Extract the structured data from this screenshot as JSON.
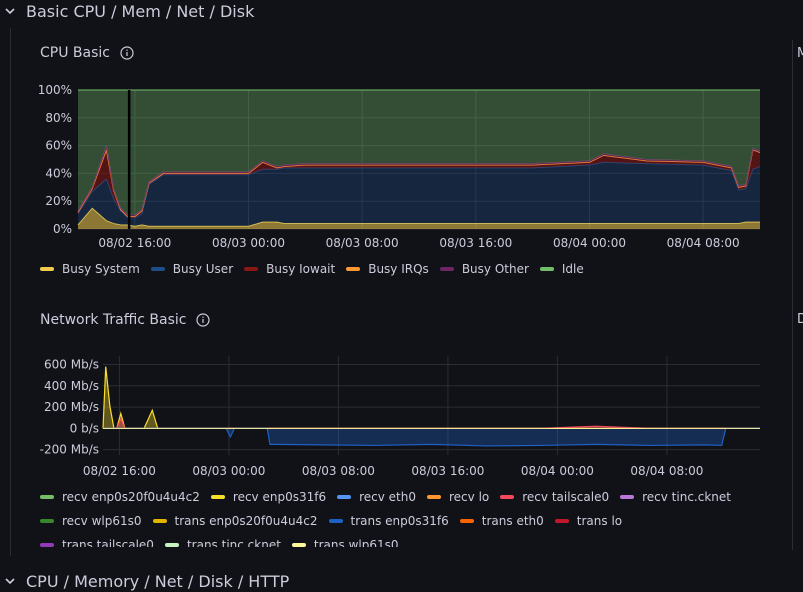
{
  "rows": [
    {
      "title": "Basic CPU / Mem / Net / Disk"
    },
    {
      "title": "CPU / Memory / Net / Disk / HTTP"
    }
  ],
  "cpu_panel": {
    "title": "CPU Basic",
    "legend": [
      {
        "label": "Busy System",
        "color": "#F2CC4C"
      },
      {
        "label": "Busy User",
        "color": "#1F4E87"
      },
      {
        "label": "Busy Iowait",
        "color": "#8A1616"
      },
      {
        "label": "Busy IRQs",
        "color": "#FF9830"
      },
      {
        "label": "Busy Other",
        "color": "#6E2564"
      },
      {
        "label": "Idle",
        "color": "#73BF69"
      }
    ]
  },
  "net_panel": {
    "title": "Network Traffic Basic",
    "legend": [
      {
        "label": "recv enp0s20f0u4u4c2",
        "color": "#73BF69"
      },
      {
        "label": "recv enp0s31f6",
        "color": "#FADE2A"
      },
      {
        "label": "recv eth0",
        "color": "#5794F2"
      },
      {
        "label": "recv lo",
        "color": "#FF9830"
      },
      {
        "label": "recv tailscale0",
        "color": "#F2495C"
      },
      {
        "label": "recv tinc.cknet",
        "color": "#B877D9"
      },
      {
        "label": "recv wlp61s0",
        "color": "#37872D"
      },
      {
        "label": "trans enp0s20f0u4u4c2",
        "color": "#E0B400"
      },
      {
        "label": "trans enp0s31f6",
        "color": "#1F60C4"
      },
      {
        "label": "trans eth0",
        "color": "#FA6400"
      },
      {
        "label": "trans lo",
        "color": "#C4162A"
      },
      {
        "label": "trans tailscale0",
        "color": "#8F3BB8"
      },
      {
        "label": "trans tinc.cknet",
        "color": "#C8F2C2"
      },
      {
        "label": "trans wlp61s0",
        "color": "#FFF899"
      }
    ]
  },
  "right_edge": {
    "top_letter": "M",
    "bottom_letter": "D"
  },
  "chart_data": [
    {
      "type": "area",
      "title": "CPU Basic",
      "x_ticks": [
        "08/02 16:00",
        "08/03 00:00",
        "08/03 08:00",
        "08/03 16:00",
        "08/04 00:00",
        "08/04 08:00"
      ],
      "y_ticks": [
        "0%",
        "20%",
        "40%",
        "60%",
        "80%",
        "100%"
      ],
      "ylim": [
        0,
        100
      ],
      "stacked": true,
      "x": [
        0,
        1,
        2,
        2.5,
        3,
        3.5,
        4,
        4.5,
        5,
        6,
        7,
        10,
        12,
        13,
        14,
        14.5,
        16,
        20,
        24,
        28,
        32,
        36,
        37,
        40,
        44,
        46,
        46.5,
        47,
        47.5,
        48
      ],
      "series": [
        {
          "name": "Busy System",
          "color": "#F2CC4C",
          "values": [
            3,
            15,
            6,
            4,
            3,
            3,
            2,
            3,
            2,
            2,
            2,
            2,
            2,
            5,
            5,
            4,
            4,
            4,
            4,
            4,
            4,
            4,
            4,
            4,
            4,
            4,
            4,
            5,
            5,
            5
          ]
        },
        {
          "name": "Busy User",
          "color": "#1F4E87",
          "values": [
            8,
            12,
            30,
            18,
            10,
            5,
            6,
            8,
            30,
            37,
            37,
            37,
            37,
            38,
            38,
            40,
            40,
            40,
            40,
            40,
            40,
            42,
            44,
            43,
            42,
            38,
            24,
            24,
            38,
            40
          ]
        },
        {
          "name": "Busy Iowait",
          "color": "#8A1616",
          "values": [
            1,
            2,
            20,
            6,
            1,
            1,
            1,
            2,
            1,
            1,
            1,
            1,
            1,
            5,
            1,
            1,
            2,
            2,
            2,
            2,
            2,
            2,
            5,
            2,
            2,
            2,
            2,
            2,
            14,
            10
          ]
        },
        {
          "name": "Busy IRQs",
          "color": "#FF9830",
          "values": [
            0,
            0,
            1,
            0,
            0,
            0,
            0,
            0,
            0,
            0,
            0,
            0,
            0,
            0,
            0,
            0,
            0,
            0,
            0,
            0,
            0,
            0,
            0,
            0,
            0,
            0,
            0,
            0,
            0,
            0
          ]
        },
        {
          "name": "Busy Other",
          "color": "#6E2564",
          "values": [
            1,
            1,
            3,
            1,
            1,
            1,
            1,
            1,
            1,
            1,
            1,
            1,
            1,
            1,
            1,
            1,
            1,
            1,
            1,
            1,
            1,
            1,
            1,
            1,
            1,
            1,
            1,
            1,
            1,
            1
          ]
        },
        {
          "name": "Idle",
          "color": "#73BF69",
          "values": [
            87,
            70,
            40,
            71,
            85,
            90,
            90,
            86,
            66,
            59,
            59,
            59,
            59,
            51,
            55,
            54,
            53,
            53,
            53,
            53,
            53,
            51,
            46,
            50,
            51,
            55,
            69,
            68,
            42,
            44
          ]
        }
      ]
    },
    {
      "type": "area",
      "title": "Network Traffic Basic",
      "x_ticks": [
        "08/02 16:00",
        "08/03 00:00",
        "08/03 08:00",
        "08/03 16:00",
        "08/04 00:00",
        "08/04 08:00"
      ],
      "y_ticks": [
        "-200 Mb/s",
        "0 b/s",
        "200 Mb/s",
        "400 Mb/s",
        "600 Mb/s"
      ],
      "ylim": [
        -250,
        680
      ],
      "x": [
        0,
        0.2,
        0.5,
        0.8,
        1,
        1.3,
        1.6,
        2,
        3,
        3.6,
        4,
        4.4,
        5,
        6,
        8,
        9,
        9.3,
        9.6,
        10,
        12,
        12.2,
        12.5,
        16,
        20,
        24,
        28,
        32,
        36,
        40,
        44,
        45.2,
        45.5,
        48
      ],
      "series": [
        {
          "name": "recv enp0s31f6",
          "color": "#FADE2A",
          "values": [
            0,
            580,
            210,
            0,
            0,
            140,
            0,
            0,
            0,
            170,
            0,
            0,
            0,
            0,
            0,
            0,
            0,
            0,
            0,
            0,
            0,
            0,
            0,
            0,
            0,
            0,
            0,
            0,
            0,
            0,
            0,
            0,
            0
          ]
        },
        {
          "name": "recv tailscale0",
          "color": "#F2495C",
          "values": [
            0,
            0,
            0,
            0,
            0,
            90,
            0,
            0,
            0,
            0,
            0,
            0,
            0,
            0,
            0,
            0,
            0,
            0,
            0,
            0,
            0,
            0,
            0,
            0,
            0,
            0,
            0,
            20,
            0,
            0,
            0,
            0,
            0
          ]
        },
        {
          "name": "trans enp0s31f6",
          "color": "#1F60C4",
          "values": [
            0,
            0,
            0,
            0,
            0,
            0,
            0,
            0,
            0,
            0,
            0,
            0,
            0,
            0,
            0,
            0,
            -80,
            0,
            0,
            0,
            -150,
            -150,
            -155,
            -160,
            -150,
            -165,
            -160,
            -150,
            -160,
            -155,
            -160,
            0,
            0
          ]
        }
      ]
    }
  ]
}
